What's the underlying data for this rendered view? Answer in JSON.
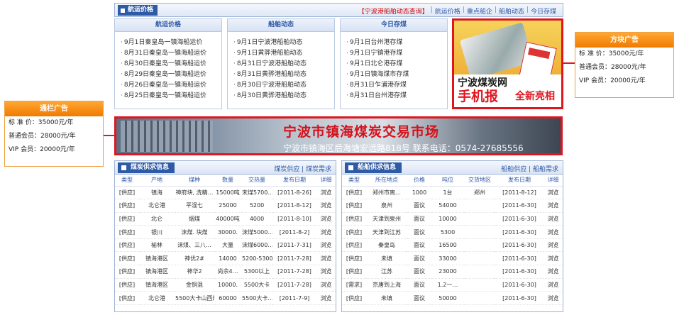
{
  "topbar": {
    "title": "航运价格",
    "links": [
      {
        "label": "【宁波港船舶动态查询】",
        "style": "red"
      },
      {
        "label": "航运价格",
        "style": "blue"
      },
      {
        "label": "重点船企",
        "style": "blue"
      },
      {
        "label": "船舶动态",
        "style": "blue"
      },
      {
        "label": "今日存煤",
        "style": "blue"
      }
    ]
  },
  "panels": [
    {
      "title": "航运价格",
      "items": [
        "9月1日秦皇岛一镇海船运价",
        "8月31日秦皇岛一镇海船运价",
        "8月30日秦皇岛一镇海船运价",
        "8月29日秦皇岛一镇海船运价",
        "8月26日秦皇岛一镇海船运价",
        "8月25日秦皇岛一镇海船运价"
      ]
    },
    {
      "title": "船舶动态",
      "items": [
        "9月1日宁波港船舶动态",
        "9月1日黄骅港船舶动态",
        "8月31日宁波港船舶动态",
        "8月31日黄骅港船舶动态",
        "8月30日宁波港船舶动态",
        "8月30日黄骅港船舶动态"
      ]
    },
    {
      "title": "今日存煤",
      "items": [
        "9月1日台州港存煤",
        "9月1日宁镇港存煤",
        "9月1日北仑港存煤",
        "9月1日镇海煤市存煤",
        "8月31日乍浦港存煤",
        "8月31日台州港存煤"
      ]
    }
  ],
  "square_ad": {
    "line1": "宁波煤炭网",
    "line2": "手机报",
    "line3": "全新亮相"
  },
  "banner": {
    "title": "宁波市镇海煤炭交易市场",
    "subtitle": "宁波市镇海区后海塘宏远路818号   联系电话：0574-27685556"
  },
  "side_square": {
    "title": "方块广告",
    "rows": [
      "标 准 价：35000元/年",
      "普通会员：28000元/年",
      "VIP 会员：20000元/年"
    ]
  },
  "side_banner": {
    "title": "通栏广告",
    "rows": [
      "标 准 价：35000元/年",
      "普通会员：28000元/年",
      "VIP 会员：20000元/年"
    ]
  },
  "coal_table": {
    "title": "煤炭供求信息",
    "links": "煤炭供应 | 煤炭需求",
    "headers": [
      "类型",
      "产地",
      "煤种",
      "数量",
      "交热量",
      "发布日期",
      "详细"
    ],
    "rows": [
      [
        "[供应]",
        "镇海",
        "神府块, 洗精…",
        "15000吨",
        "末煤5700…",
        "[2011-8-26]",
        "浏览"
      ],
      [
        "[供应]",
        "北仑港",
        "平混七",
        "25000",
        "5200",
        "[2011-8-12]",
        "浏览"
      ],
      [
        "[供应]",
        "北仑",
        "烟煤",
        "40000吨",
        "4000",
        "[2011-8-10]",
        "浏览"
      ],
      [
        "[供应]",
        "银川",
        "沫煤. 块煤",
        "30000.",
        "沫煤5000…",
        "[2011-8-2]",
        "浏览"
      ],
      [
        "[供应]",
        "榆林",
        "沫煤、三八…",
        "大量",
        "沫煤6000…",
        "[2011-7-31]",
        "浏览"
      ],
      [
        "[供应]",
        "镇海港区",
        "神优2#",
        "14000",
        "5200-5300",
        "[2011-7-28]",
        "浏览"
      ],
      [
        "[供应]",
        "镇海港区",
        "神华2",
        "尚余4…",
        "5300以上",
        "[2011-7-28]",
        "浏览"
      ],
      [
        "[供应]",
        "镇海港区",
        "金铜混",
        "10000.",
        "5500大卡",
        "[2011-7-28]",
        "浏览"
      ],
      [
        "[供应]",
        "北仑港",
        "5500大卡山西煤",
        "60000",
        "5500大卡…",
        "[2011-7-9]",
        "浏览"
      ]
    ]
  },
  "ship_table": {
    "title": "船舶供求信息",
    "links": "船舶供应 | 船舶需求",
    "headers": [
      "类型",
      "所在地点",
      "价格",
      "吨位",
      "交货地区",
      "发布日期",
      "详细"
    ],
    "rows": [
      [
        "[供应]",
        "郑州市离…",
        "1000",
        "1台",
        "郑州",
        "[2011-8-12]",
        "浏览"
      ],
      [
        "[供应]",
        "泉州",
        "面议",
        "54000",
        "",
        "[2011-6-30]",
        "浏览"
      ],
      [
        "[供应]",
        "天津到泉州",
        "面议",
        "10000",
        "",
        "[2011-6-30]",
        "浏览"
      ],
      [
        "[供应]",
        "天津到江苏",
        "面议",
        "5300",
        "",
        "[2011-6-30]",
        "浏览"
      ],
      [
        "[供应]",
        "秦皇岛",
        "面议",
        "16500",
        "",
        "[2011-6-30]",
        "浏览"
      ],
      [
        "[供应]",
        "未填",
        "面议",
        "33000",
        "",
        "[2011-6-30]",
        "浏览"
      ],
      [
        "[供应]",
        "江苏",
        "面议",
        "23000",
        "",
        "[2011-6-30]",
        "浏览"
      ],
      [
        "[需求]",
        "京唐到上海",
        "面议",
        "1.2一…",
        "",
        "[2011-6-30]",
        "浏览"
      ],
      [
        "[供应]",
        "未填",
        "面议",
        "50000",
        "",
        "[2011-6-30]",
        "浏览"
      ]
    ]
  }
}
